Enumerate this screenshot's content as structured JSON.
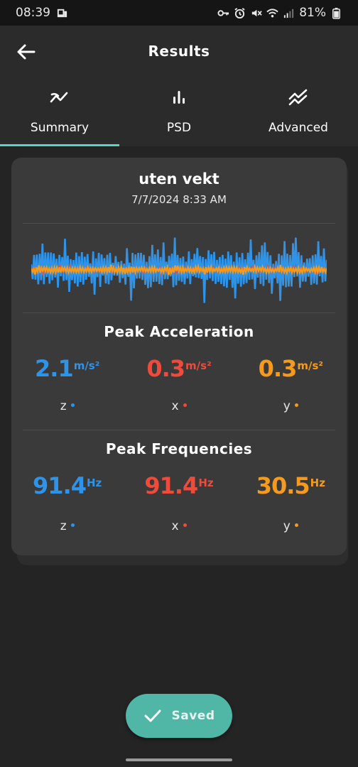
{
  "status_bar": {
    "time": "08:39",
    "battery": "81%"
  },
  "header": {
    "title": "Results"
  },
  "tabs": [
    {
      "label": "Summary",
      "icon": "trending-chart-icon",
      "active": true
    },
    {
      "label": "PSD",
      "icon": "bar-chart-icon",
      "active": false
    },
    {
      "label": "Advanced",
      "icon": "multi-line-chart-icon",
      "active": false
    }
  ],
  "measurement": {
    "name": "uten vekt",
    "datetime": "7/7/2024 8:33 AM"
  },
  "waveform": {
    "series": [
      {
        "axis": "z",
        "color": "#2f93e8"
      },
      {
        "axis": "x",
        "color": "#f04a3a"
      },
      {
        "axis": "y",
        "color": "#f59a1b"
      }
    ]
  },
  "peak_acceleration": {
    "title": "Peak Acceleration",
    "unit": "m/s²",
    "items": [
      {
        "axis": "z",
        "value": "2.1",
        "color": "#2f93e8"
      },
      {
        "axis": "x",
        "value": "0.3",
        "color": "#f04a3a"
      },
      {
        "axis": "y",
        "value": "0.3",
        "color": "#f59a1b"
      }
    ]
  },
  "peak_frequencies": {
    "title": "Peak Frequencies",
    "unit": "Hz",
    "items": [
      {
        "axis": "z",
        "value": "91.4",
        "color": "#2f93e8"
      },
      {
        "axis": "x",
        "value": "91.4",
        "color": "#f04a3a"
      },
      {
        "axis": "y",
        "value": "30.5",
        "color": "#f59a1b"
      }
    ]
  },
  "saved_button": {
    "label": "Saved"
  },
  "colors": {
    "accent": "#5bd6c3",
    "saved_bg": "#50b7a6"
  }
}
